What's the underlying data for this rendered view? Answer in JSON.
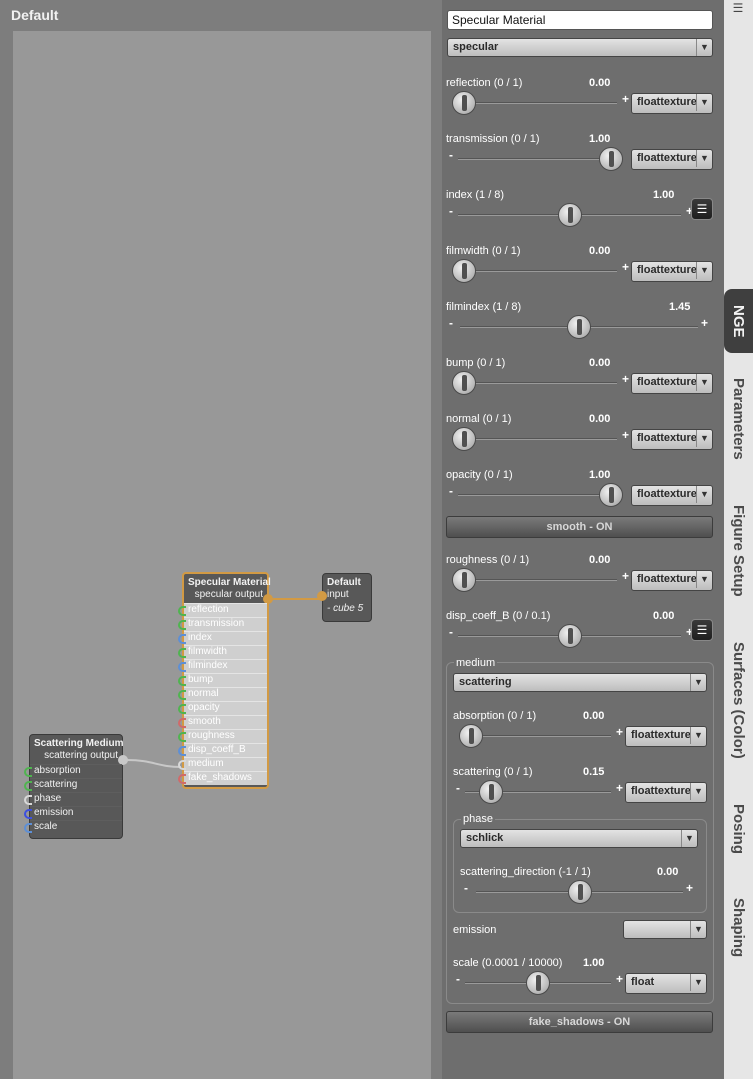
{
  "editor": {
    "title": "Default",
    "nodes": {
      "specular": {
        "title": "Specular Material",
        "output": "specular output",
        "inputs": [
          {
            "label": "reflection",
            "pin": "g"
          },
          {
            "label": "transmission",
            "pin": "g"
          },
          {
            "label": "index",
            "pin": "b"
          },
          {
            "label": "filmwidth",
            "pin": "g"
          },
          {
            "label": "filmindex",
            "pin": "b"
          },
          {
            "label": "bump",
            "pin": "g"
          },
          {
            "label": "normal",
            "pin": "g"
          },
          {
            "label": "opacity",
            "pin": "g"
          },
          {
            "label": "smooth",
            "pin": "r"
          },
          {
            "label": "roughness",
            "pin": "g"
          },
          {
            "label": "disp_coeff_B",
            "pin": "b"
          },
          {
            "label": "medium",
            "pin": "w"
          },
          {
            "label": "fake_shadows",
            "pin": "r"
          }
        ]
      },
      "default": {
        "title": "Default",
        "input": "input",
        "item": "- cube 5"
      },
      "scattering": {
        "title": "Scattering Medium",
        "output": "scattering output",
        "inputs": [
          {
            "label": "absorption",
            "pin": "g"
          },
          {
            "label": "scattering",
            "pin": "g"
          },
          {
            "label": "phase",
            "pin": "w"
          },
          {
            "label": "emission",
            "pin": "bl"
          },
          {
            "label": "scale",
            "pin": "b"
          }
        ]
      }
    }
  },
  "panel": {
    "material_name": "Specular Material",
    "material_type": "specular",
    "params": {
      "reflection": {
        "label": "reflection (0 / 1)",
        "value": "0.00",
        "fraction": 0.0,
        "minus": "",
        "plus": "+",
        "dropdown": "floattexture"
      },
      "transmission": {
        "label": "transmission (0 / 1)",
        "value": "1.00",
        "fraction": 1.0,
        "minus": "-",
        "plus": "",
        "dropdown": "floattexture"
      },
      "index": {
        "label": "index (1 / 8)",
        "value": "1.00",
        "fraction": 0.5,
        "minus": "-",
        "plus": "+"
      },
      "filmwidth": {
        "label": "filmwidth (0 / 1)",
        "value": "0.00",
        "fraction": 0.0,
        "minus": "",
        "plus": "+",
        "dropdown": "floattexture"
      },
      "filmindex": {
        "label": "filmindex (1 / 8)",
        "value": "1.45",
        "fraction": 0.5,
        "minus": "-",
        "plus": "+"
      },
      "bump": {
        "label": "bump (0 / 1)",
        "value": "0.00",
        "fraction": 0.0,
        "minus": "",
        "plus": "+",
        "dropdown": "floattexture"
      },
      "normal": {
        "label": "normal (0 / 1)",
        "value": "0.00",
        "fraction": 0.0,
        "minus": "",
        "plus": "+",
        "dropdown": "floattexture"
      },
      "opacity": {
        "label": "opacity (0 / 1)",
        "value": "1.00",
        "fraction": 1.0,
        "minus": "-",
        "plus": "",
        "dropdown": "floattexture"
      },
      "roughness": {
        "label": "roughness (0 / 1)",
        "value": "0.00",
        "fraction": 0.0,
        "minus": "",
        "plus": "+",
        "dropdown": "floattexture"
      },
      "disp_coeff_B": {
        "label": "disp_coeff_B (0 / 0.1)",
        "value": "0.00",
        "fraction": 0.5,
        "minus": "-",
        "plus": "+"
      }
    },
    "smooth_toggle": "smooth - ON",
    "medium": {
      "label": "medium",
      "type": "scattering",
      "absorption": {
        "label": "absorption (0 / 1)",
        "value": "0.00",
        "fraction": 0.0,
        "minus": "",
        "plus": "+",
        "dropdown": "floattexture"
      },
      "scattering": {
        "label": "scattering (0 / 1)",
        "value": "0.15",
        "fraction": 0.15,
        "minus": "-",
        "plus": "+",
        "dropdown": "floattexture"
      },
      "phase": {
        "label": "phase",
        "type": "schlick",
        "direction": {
          "label": "scattering_direction (-1 / 1)",
          "value": "0.00",
          "fraction": 0.5,
          "minus": "-",
          "plus": "+"
        }
      },
      "emission_label": "emission",
      "emission_dropdown": "",
      "scale": {
        "label": "scale (0.0001 / 10000)",
        "value": "1.00",
        "fraction": 0.5,
        "minus": "-",
        "plus": "+",
        "dropdown": "float"
      }
    },
    "fake_shadows_toggle": "fake_shadows - ON"
  },
  "tabs": [
    "NGE",
    "Parameters",
    "Figure Setup",
    "Surfaces (Color)",
    "Posing",
    "Shaping"
  ],
  "active_tab": "NGE",
  "colors": {
    "accent": "#d29a44",
    "wire_orange": "#d29a44",
    "wire_gray": "#c8c8c8"
  }
}
